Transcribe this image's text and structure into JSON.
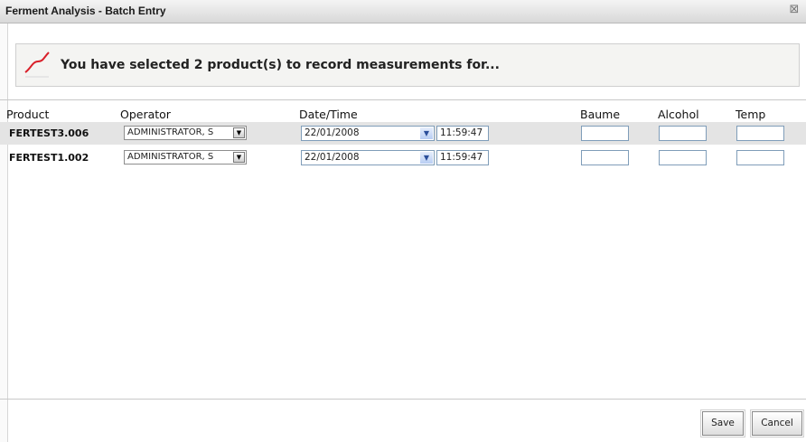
{
  "window": {
    "title": "Ferment Analysis - Batch Entry",
    "close_glyph": "⊠"
  },
  "banner": {
    "message": "You have selected 2 product(s) to record measurements for...",
    "icon": "trend-line-icon"
  },
  "columns": {
    "product": "Product",
    "operator": "Operator",
    "datetime": "Date/Time",
    "baume": "Baume",
    "alcohol": "Alcohol",
    "temp": "Temp"
  },
  "rows": [
    {
      "product": "FERTEST3.006",
      "operator": "ADMINISTRATOR, S",
      "date": "22/01/2008",
      "time": "11:59:47",
      "baume": "",
      "alcohol": "",
      "temp": ""
    },
    {
      "product": "FERTEST1.002",
      "operator": "ADMINISTRATOR, S",
      "date": "22/01/2008",
      "time": "11:59:47",
      "baume": "",
      "alcohol": "",
      "temp": ""
    }
  ],
  "footer": {
    "save_label": "Save",
    "cancel_label": "Cancel"
  },
  "colors": {
    "accent_icon": "#d9202a",
    "row_alt": "#e4e4e4"
  }
}
